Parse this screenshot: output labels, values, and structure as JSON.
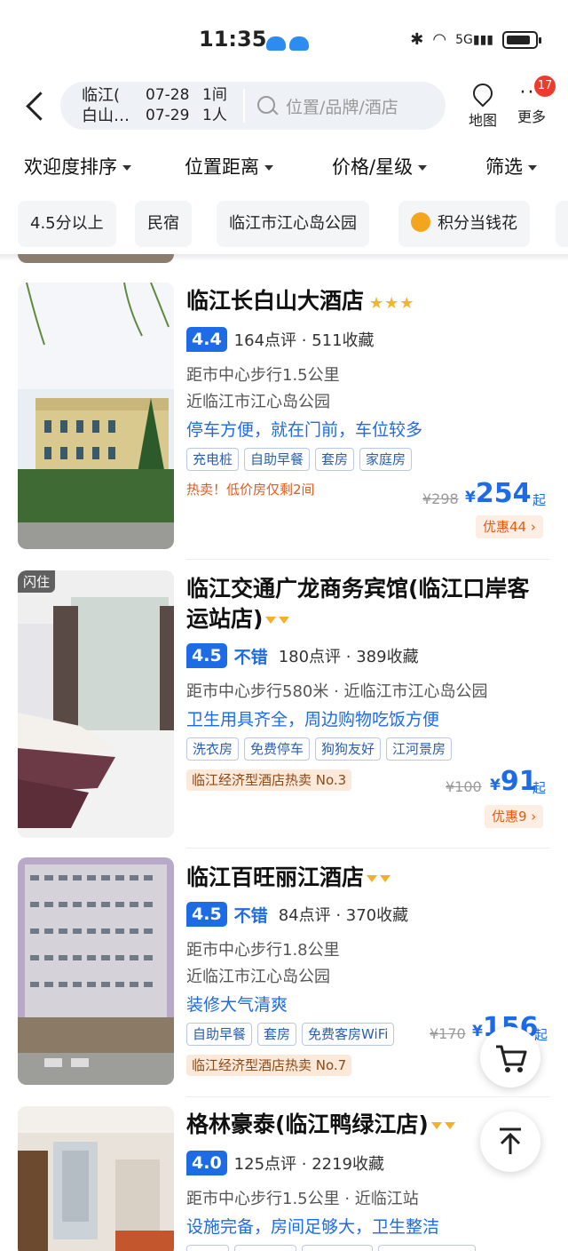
{
  "status": {
    "time": "11:35",
    "network": "5G"
  },
  "header": {
    "city": "临江(白山…",
    "city_line1": "临江(",
    "city_line2": "白山…",
    "checkin": "07-28",
    "checkout": "07-29",
    "rooms": "1间",
    "guests": "1人",
    "search_placeholder": "位置/品牌/酒店",
    "map_label": "地图",
    "more_label": "更多",
    "more_badge": "17"
  },
  "sort": {
    "items": [
      "欢迎度排序",
      "位置距离",
      "价格/星级",
      "筛选"
    ]
  },
  "chips": [
    "4.5分以上",
    "民宿",
    "临江市江心岛公园",
    "积分当钱花"
  ],
  "colors": {
    "accent": "#1e6be6",
    "star": "#f5b32d",
    "deal": "#e35b12",
    "badge": "#ee3b2f"
  },
  "hotels": [
    {
      "name": "临江长白山大酒店",
      "stars": "★★★",
      "score": "4.4",
      "reviews": "164点评 · 511收藏",
      "distance": "距市中心步行1.5公里",
      "near": "近临江市江心岛公园",
      "highlight": "停车方便，就在门前，车位较多",
      "tags": [
        "充电桩",
        "自助早餐",
        "套房",
        "家庭房"
      ],
      "hot": "热卖！低价房仅剩2间",
      "orig_price": "¥298",
      "currency": "¥",
      "price": "254",
      "qi": "起",
      "deal": "优惠44 ›"
    },
    {
      "name": "临江交通广龙商务宾馆(临江口岸客运站店)",
      "badge": "闪住",
      "score": "4.5",
      "score_text": "不错",
      "reviews": "180点评 · 389收藏",
      "distance": "距市中心步行580米 · 近临江市江心岛公园",
      "highlight": "卫生用具齐全，周边购物吃饭方便",
      "tags": [
        "洗衣房",
        "免费停车",
        "狗狗友好",
        "江河景房"
      ],
      "rank": "临江经济型酒店热卖 No.3",
      "orig_price": "¥100",
      "currency": "¥",
      "price": "91",
      "qi": "起",
      "deal": "优惠9 ›"
    },
    {
      "name": "临江百旺丽江酒店",
      "score": "4.5",
      "score_text": "不错",
      "reviews": "84点评 · 370收藏",
      "distance": "距市中心步行1.8公里",
      "near": "近临江市江心岛公园",
      "highlight": "装修大气清爽",
      "tags": [
        "自助早餐",
        "套房",
        "免费客房WiFi"
      ],
      "rank": "临江经济型酒店热卖 No.7",
      "orig_price": "¥170",
      "currency": "¥",
      "price": "156",
      "qi": "起"
    },
    {
      "name": "格林豪泰(临江鸭绿江店)",
      "score": "4.0",
      "reviews": "125点评 · 2219收藏",
      "distance": "距市中心步行1.5公里 · 近临江站",
      "highlight": "设施完备，房间足够大，卫生整洁"
    }
  ]
}
